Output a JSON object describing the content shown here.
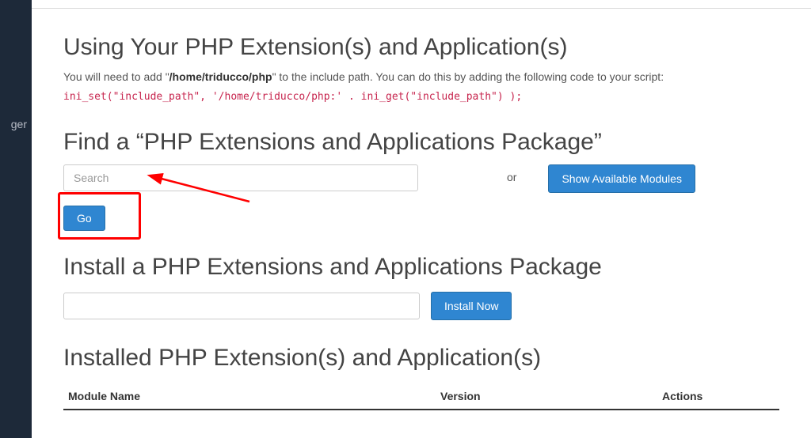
{
  "sidebar": {
    "partial_label": "ger"
  },
  "using": {
    "title": "Using Your PHP Extension(s) and Application(s)",
    "intro_pre": "You will need to add \"",
    "intro_path": "/home/triducco/php",
    "intro_post": "\" to the include path. You can do this by adding the following code to your script:",
    "code": "ini_set(\"include_path\", '/home/triducco/php:' . ini_get(\"include_path\") );"
  },
  "find": {
    "title": "Find a “PHP Extensions and Applications Package”",
    "search_placeholder": "Search",
    "go_label": "Go",
    "or_label": "or",
    "show_label": "Show Available Modules"
  },
  "install": {
    "title": "Install a PHP Extensions and Applications Package",
    "install_label": "Install Now"
  },
  "installed": {
    "title": "Installed PHP Extension(s) and Application(s)",
    "col_module": "Module Name",
    "col_version": "Version",
    "col_actions": "Actions"
  }
}
